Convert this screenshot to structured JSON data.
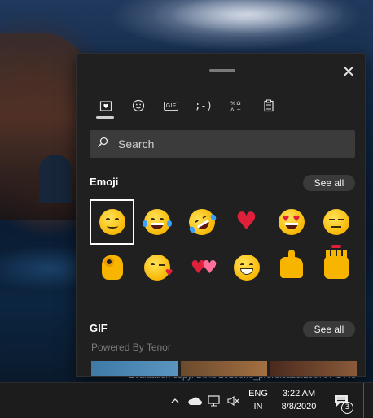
{
  "panel": {
    "close_glyph": "✕",
    "tabs": [
      {
        "name": "Most used",
        "icon": "heart-icon",
        "active": true
      },
      {
        "name": "Smileys",
        "icon": "smiley-icon",
        "active": false
      },
      {
        "name": "GIF",
        "text": "GIF",
        "active": false
      },
      {
        "name": "Kaomoji",
        "text": ";-)",
        "active": false
      },
      {
        "name": "Symbols",
        "icon": "symbols-icon",
        "active": false
      },
      {
        "name": "Clipboard",
        "icon": "clipboard-icon",
        "active": false
      }
    ],
    "search": {
      "placeholder": "Search",
      "value": ""
    },
    "emoji_section": {
      "title": "Emoji",
      "see_all": "See all",
      "items": [
        {
          "name": "smiling-face",
          "selected": true
        },
        {
          "name": "face-with-tears-of-joy"
        },
        {
          "name": "rolling-on-floor-laughing"
        },
        {
          "name": "red-heart"
        },
        {
          "name": "heart-eyes"
        },
        {
          "name": "unamused-face"
        },
        {
          "name": "ok-hand"
        },
        {
          "name": "face-blowing-kiss"
        },
        {
          "name": "two-hearts"
        },
        {
          "name": "grinning-face"
        },
        {
          "name": "thumbs-up"
        },
        {
          "name": "raising-hands"
        }
      ]
    },
    "gif_section": {
      "title": "GIF",
      "see_all": "See all",
      "powered_by": "Powered By Tenor"
    }
  },
  "watermark": "Evaluation copy. Build 20190.rs_prerelease.200707-1445",
  "taskbar": {
    "tray_icons": [
      "chevron-up-icon",
      "onedrive-cloud-icon",
      "network-icon",
      "volume-muted-icon"
    ],
    "language": {
      "line1": "ENG",
      "line2": "IN"
    },
    "clock": {
      "time": "3:22 AM",
      "date": "8/8/2020"
    },
    "notifications_count": "3"
  },
  "colors": {
    "panel_bg": "#202020",
    "search_bg": "#3b3b3b",
    "see_all_bg": "#3a3a3a",
    "taskbar_bg": "#1c1c1c",
    "heart": "#e0203a",
    "emoji_yellow": "#f7b500"
  }
}
